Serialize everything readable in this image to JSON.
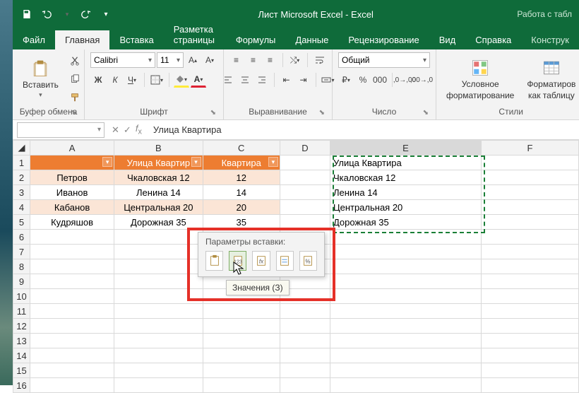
{
  "title": "Лист Microsoft Excel  -  Excel",
  "right_hint": "Работа с табл",
  "tabs": {
    "file": "Файл",
    "home": "Главная",
    "insert": "Вставка",
    "layout": "Разметка страницы",
    "formulas": "Формулы",
    "data": "Данные",
    "review": "Рецензирование",
    "view": "Вид",
    "help": "Справка",
    "design": "Конструк"
  },
  "ribbon": {
    "clipboard": {
      "paste": "Вставить",
      "label": "Буфер обмена"
    },
    "font": {
      "name": "Calibri",
      "size": "11",
      "label": "Шрифт"
    },
    "align": {
      "label": "Выравнивание"
    },
    "number": {
      "format": "Общий",
      "label": "Число"
    },
    "styles": {
      "condfmt_l1": "Условное",
      "condfmt_l2": "форматирование",
      "fmttbl_l1": "Форматиров",
      "fmttbl_l2": "как таблицу",
      "label": "Стили"
    }
  },
  "formula_bar": {
    "namebox": "",
    "formula": "Улица Квартира"
  },
  "columns": [
    "A",
    "B",
    "C",
    "D",
    "E",
    "F"
  ],
  "headers": {
    "a": "",
    "b": "Улица Квартир",
    "c": "Квартира"
  },
  "rows": [
    {
      "n": "1",
      "a": "",
      "b": "",
      "c": "",
      "e": "Улица Квартира"
    },
    {
      "n": "2",
      "a": "Петров",
      "b": "Чкаловская 12",
      "c": "12",
      "e": "Чкаловская 12"
    },
    {
      "n": "3",
      "a": "Иванов",
      "b": "Ленина 14",
      "c": "14",
      "e": "Ленина 14"
    },
    {
      "n": "4",
      "a": "Кабанов",
      "b": "Центральная 20",
      "c": "20",
      "e": "Центральная 20"
    },
    {
      "n": "5",
      "a": "Кудряшов",
      "b": "Дорожная 35",
      "c": "35",
      "e": "Дорожная 35"
    }
  ],
  "paste_options": {
    "title": "Параметры вставки:",
    "tooltip": "Значения (З)"
  }
}
